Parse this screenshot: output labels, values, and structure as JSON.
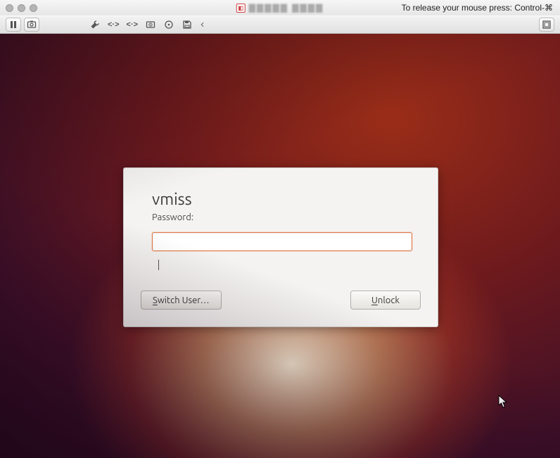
{
  "titlebar": {
    "hint": "To release your mouse press: Control-⌘",
    "document_title": "▇▇▇▇▇ ▇▇▇▇"
  },
  "vmbar": {
    "pause_tip": "Pause",
    "snapshot_tip": "Snapshot",
    "settings_tip": "Settings",
    "net1_tip": "Network Adapter",
    "net2_tip": "Network Adapter 2",
    "disk_tip": "Hard Disk",
    "cd_tip": "CD/DVD",
    "floppy_tip": "Floppy",
    "collapse_tip": "Collapse",
    "fullscreen_tip": "Full Screen"
  },
  "lock": {
    "username": "vmiss",
    "password_label": "Password:",
    "password_value": "",
    "switch_user_label": "Switch User…",
    "unlock_label": "Unlock",
    "switch_user_accel": "S",
    "unlock_accel": "U"
  }
}
